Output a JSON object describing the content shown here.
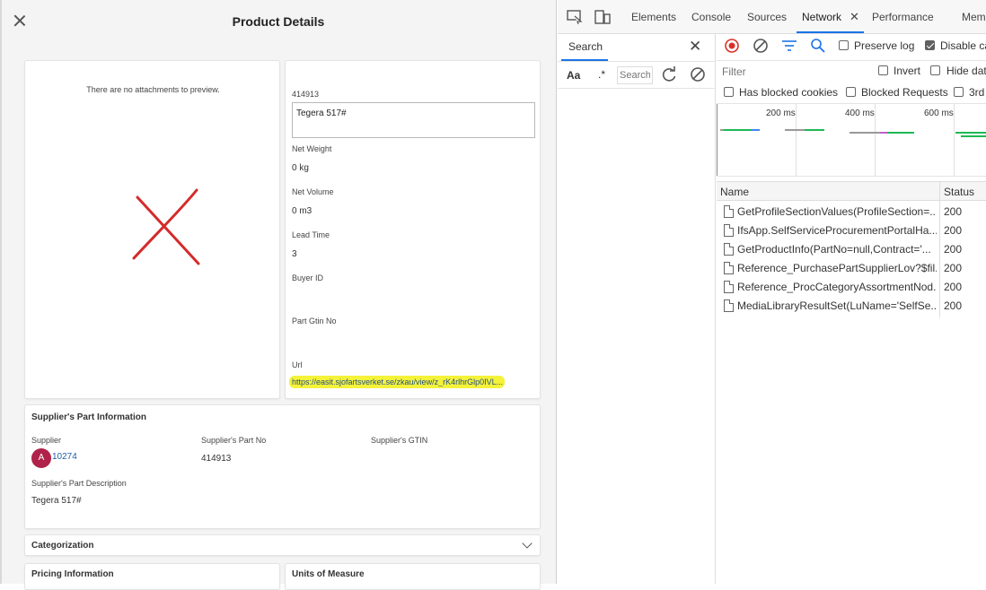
{
  "left": {
    "title": "Product Details",
    "attachments": {
      "empty_text": "There are no attachments to preview."
    },
    "product": {
      "part_no_label": "414913",
      "description_value": "Tegera 517#",
      "net_weight_label": "Net Weight",
      "net_weight_value": "0 kg",
      "net_volume_label": "Net Volume",
      "net_volume_value": "0 m3",
      "lead_time_label": "Lead Time",
      "lead_time_value": "3",
      "buyer_id_label": "Buyer ID",
      "gtin_label": "Part Gtin No",
      "url_label": "Url",
      "url_value": "https://easit.sjofartsverket.se/zkau/view/z_rK4rlhrGlp0IVL..."
    },
    "supplier_section": {
      "title": "Supplier's Part Information",
      "supplier_label": "Supplier",
      "avatar_letter": "A",
      "supplier_value": "10274",
      "supplier_part_no_label": "Supplier's Part No",
      "supplier_part_no_value": "414913",
      "supplier_gtin_label": "Supplier's GTIN",
      "desc_label": "Supplier's Part Description",
      "desc_value": "Tegera 517#"
    },
    "categorization": {
      "title": "Categorization"
    },
    "pricing": {
      "title": "Pricing Information"
    },
    "units": {
      "title": "Units of Measure"
    }
  },
  "devtools": {
    "tabs": [
      "Elements",
      "Console",
      "Sources",
      "Network",
      "Performance",
      "Mem"
    ],
    "search_tab": "Search",
    "search_case_label": "Aa",
    "search_regex_label": ".*",
    "search_placeholder": "Search",
    "preserve_log": "Preserve log",
    "disable_cache": "Disable ca",
    "filter_placeholder": "Filter",
    "invert": "Invert",
    "hide_data": "Hide dat",
    "has_blocked_cookies": "Has blocked cookies",
    "blocked_requests": "Blocked Requests",
    "third_party": "3rd",
    "timeline_ticks": [
      "200 ms",
      "400 ms",
      "600 ms"
    ],
    "col_name": "Name",
    "col_status": "Status",
    "requests": [
      {
        "name": "GetProfileSectionValues(ProfileSection=...",
        "status": "200"
      },
      {
        "name": "IfsApp.SelfServiceProcurementPortalHa...",
        "status": "200"
      },
      {
        "name": "GetProductInfo(PartNo=null,Contract='...",
        "status": "200"
      },
      {
        "name": "Reference_PurchasePartSupplierLov?$fil...",
        "status": "200"
      },
      {
        "name": "Reference_ProcCategoryAssortmentNod...",
        "status": "200"
      },
      {
        "name": "MediaLibraryResultSet(LuName='SelfSe...",
        "status": "200"
      }
    ]
  }
}
